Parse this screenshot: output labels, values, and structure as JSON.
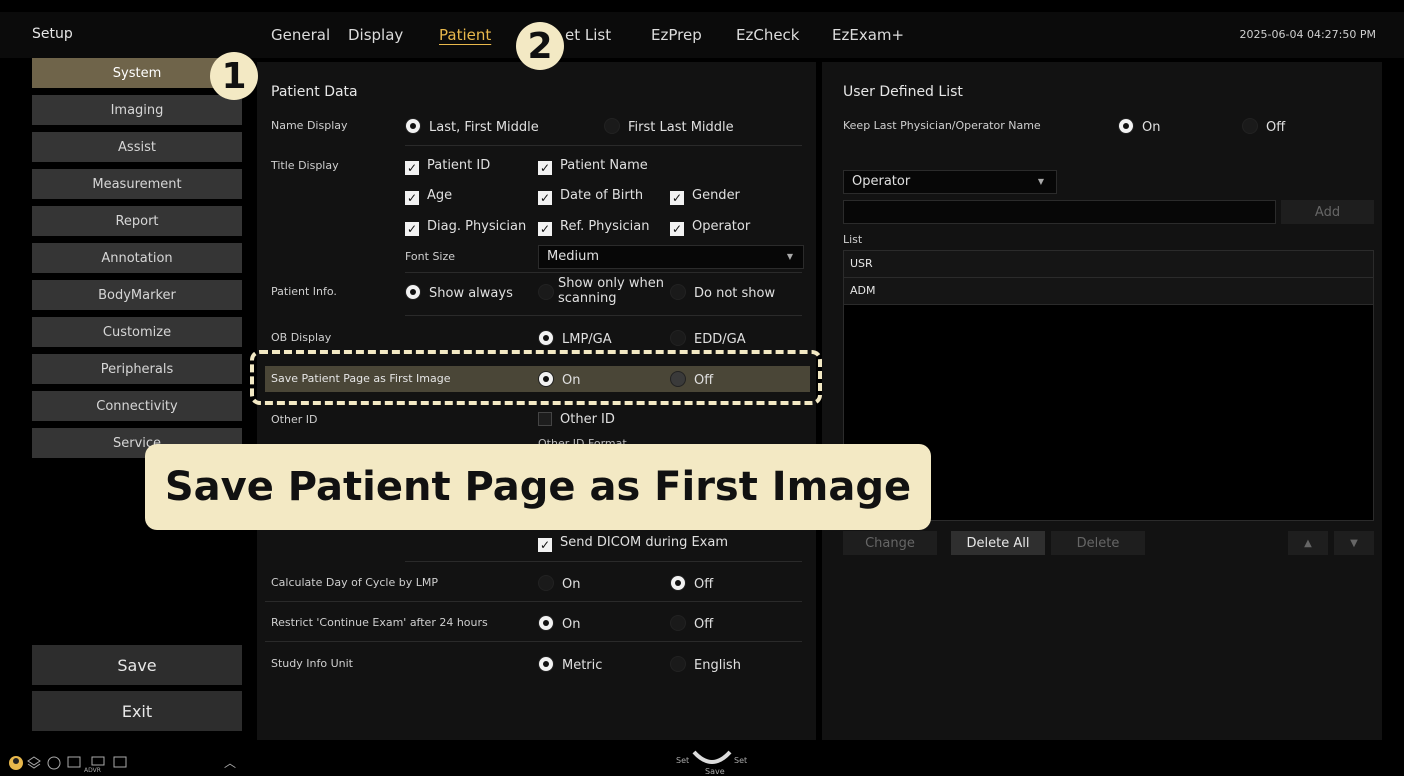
{
  "header": {
    "title": "Setup",
    "tabs": [
      "General",
      "Display",
      "Patient",
      "Preset List",
      "EzPrep",
      "EzCheck",
      "EzExam+"
    ],
    "tab_visible": [
      "General",
      "Display",
      "Patient",
      "et List",
      "EzPrep",
      "EzCheck",
      "EzExam+"
    ],
    "active_tab": "Patient",
    "datetime": "2025-06-04 04:27:50 PM"
  },
  "sidebar": {
    "items": [
      "System",
      "Imaging",
      "Assist",
      "Measurement",
      "Report",
      "Annotation",
      "BodyMarker",
      "Customize",
      "Peripherals",
      "Connectivity",
      "Service"
    ],
    "active": "System",
    "save_label": "Save",
    "exit_label": "Exit"
  },
  "patient_data": {
    "heading": "Patient Data",
    "name_display": {
      "label": "Name Display",
      "options": [
        "Last, First Middle",
        "First Last Middle"
      ],
      "selected": "Last, First Middle"
    },
    "title_display": {
      "label": "Title Display",
      "items": [
        "Patient ID",
        "Patient Name",
        "Age",
        "Date of Birth",
        "Gender",
        "Diag. Physician",
        "Ref. Physician",
        "Operator"
      ],
      "checked": [
        "Patient ID",
        "Patient Name",
        "Age",
        "Date of Birth",
        "Gender",
        "Diag. Physician",
        "Ref. Physician",
        "Operator"
      ],
      "font_size_label": "Font Size",
      "font_size_value": "Medium"
    },
    "patient_info": {
      "label": "Patient Info.",
      "options": [
        "Show always",
        "Show only when scanning",
        "Do not show"
      ],
      "selected": "Show always"
    },
    "ob_display": {
      "label": "OB Display",
      "options": [
        "LMP/GA",
        "EDD/GA"
      ],
      "selected": "LMP/GA"
    },
    "save_first_image": {
      "label": "Save Patient Page as First Image",
      "options": [
        "On",
        "Off"
      ],
      "selected": "On"
    },
    "other_id": {
      "label": "Other ID",
      "checkbox": "Other ID",
      "checked": false,
      "partial_text": "Other ID Format"
    },
    "send_dicom": {
      "label": "Send DICOM during Exam",
      "checked": true
    },
    "cycle_lmp": {
      "label": "Calculate Day of Cycle by LMP",
      "options": [
        "On",
        "Off"
      ],
      "selected": "Off"
    },
    "restrict_continue": {
      "label": "Restrict 'Continue Exam' after 24 hours",
      "options": [
        "On",
        "Off"
      ],
      "selected": "On"
    },
    "study_info": {
      "label": "Study Info Unit",
      "options": [
        "Metric",
        "English"
      ],
      "selected": "Metric"
    }
  },
  "user_defined": {
    "heading": "User Defined List",
    "keep_last": {
      "label": "Keep Last Physician/Operator Name",
      "options": [
        "On",
        "Off"
      ],
      "selected": "On"
    },
    "category_value": "Operator",
    "input_value": "",
    "add_label": "Add",
    "list_label": "List",
    "list_items": [
      "USR",
      "ADM"
    ],
    "buttons": {
      "change": "Change",
      "delete_all": "Delete All",
      "delete": "Delete"
    }
  },
  "overlay": {
    "step1": "1",
    "step2": "2",
    "callout": "Save Patient Page as First Image"
  },
  "statusbar": {
    "set_left": "Set",
    "set_right": "Set",
    "save": "Save",
    "advr": "ADVR"
  }
}
